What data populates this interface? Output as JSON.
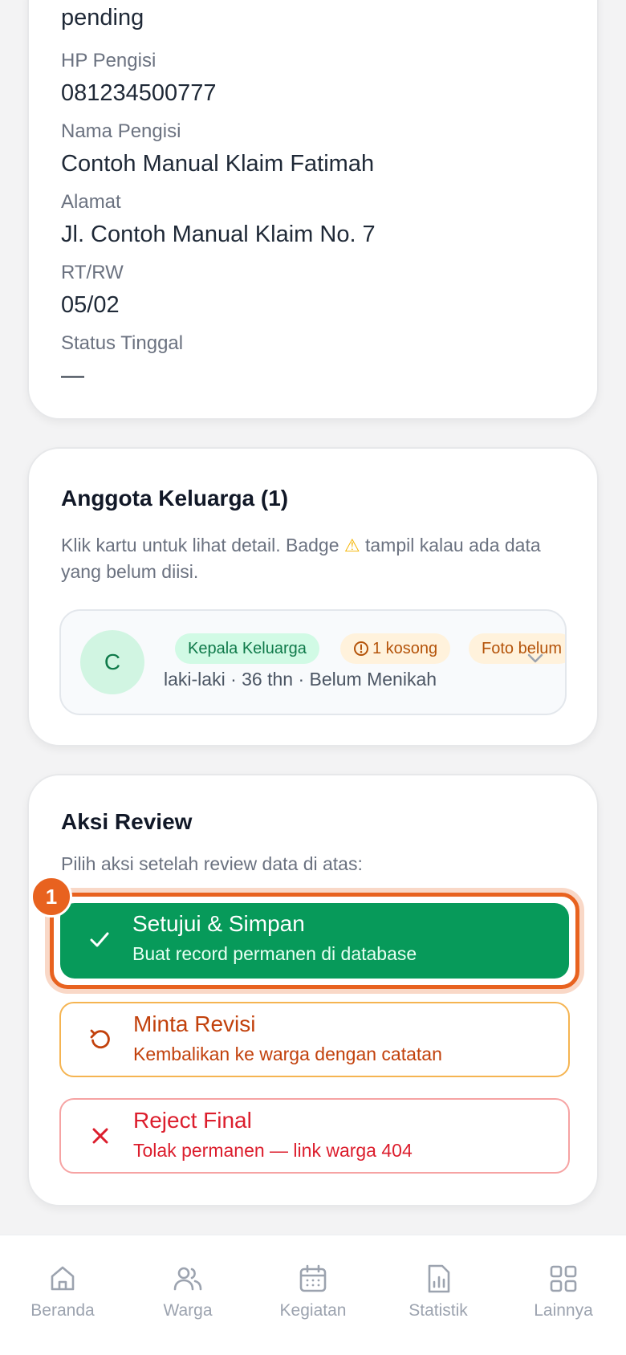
{
  "info": {
    "status_value": "pending",
    "fields": [
      {
        "label": "HP Pengisi",
        "value": "081234500777"
      },
      {
        "label": "Nama Pengisi",
        "value": "Contoh Manual Klaim Fatimah"
      },
      {
        "label": "Alamat",
        "value": "Jl. Contoh Manual Klaim No. 7"
      },
      {
        "label": "RT/RW",
        "value": "05/02"
      },
      {
        "label": "Status Tinggal",
        "value": "—"
      }
    ]
  },
  "family": {
    "title": "Anggota Keluarga (1)",
    "desc_before": "Klik kartu untuk lihat detail. Badge",
    "desc_after": "tampil kalau ada data yang belum diisi.",
    "members": [
      {
        "initial": "C",
        "badge_role": "Kepala Keluarga",
        "badge_empty": "1 kosong",
        "badge_foto": "Foto belum",
        "meta": "laki-laki · 36 thn · Belum Menikah"
      }
    ]
  },
  "review": {
    "title": "Aksi Review",
    "desc": "Pilih aksi setelah review data di atas:",
    "step_number": "1",
    "approve": {
      "title": "Setujui & Simpan",
      "subtitle": "Buat record permanen di database"
    },
    "revise": {
      "title": "Minta Revisi",
      "subtitle": "Kembalikan ke warga dengan catatan"
    },
    "reject": {
      "title": "Reject Final",
      "subtitle": "Tolak permanen — link warga 404"
    }
  },
  "nav": {
    "items": [
      {
        "label": "Beranda",
        "icon": "home-icon"
      },
      {
        "label": "Warga",
        "icon": "users-icon"
      },
      {
        "label": "Kegiatan",
        "icon": "calendar-icon"
      },
      {
        "label": "Statistik",
        "icon": "chart-icon"
      },
      {
        "label": "Lainnya",
        "icon": "grid-icon"
      }
    ]
  },
  "colors": {
    "approve": "#079a5a",
    "highlight": "#e8621f",
    "revise": "#c2410c",
    "reject": "#dc1e2d"
  }
}
